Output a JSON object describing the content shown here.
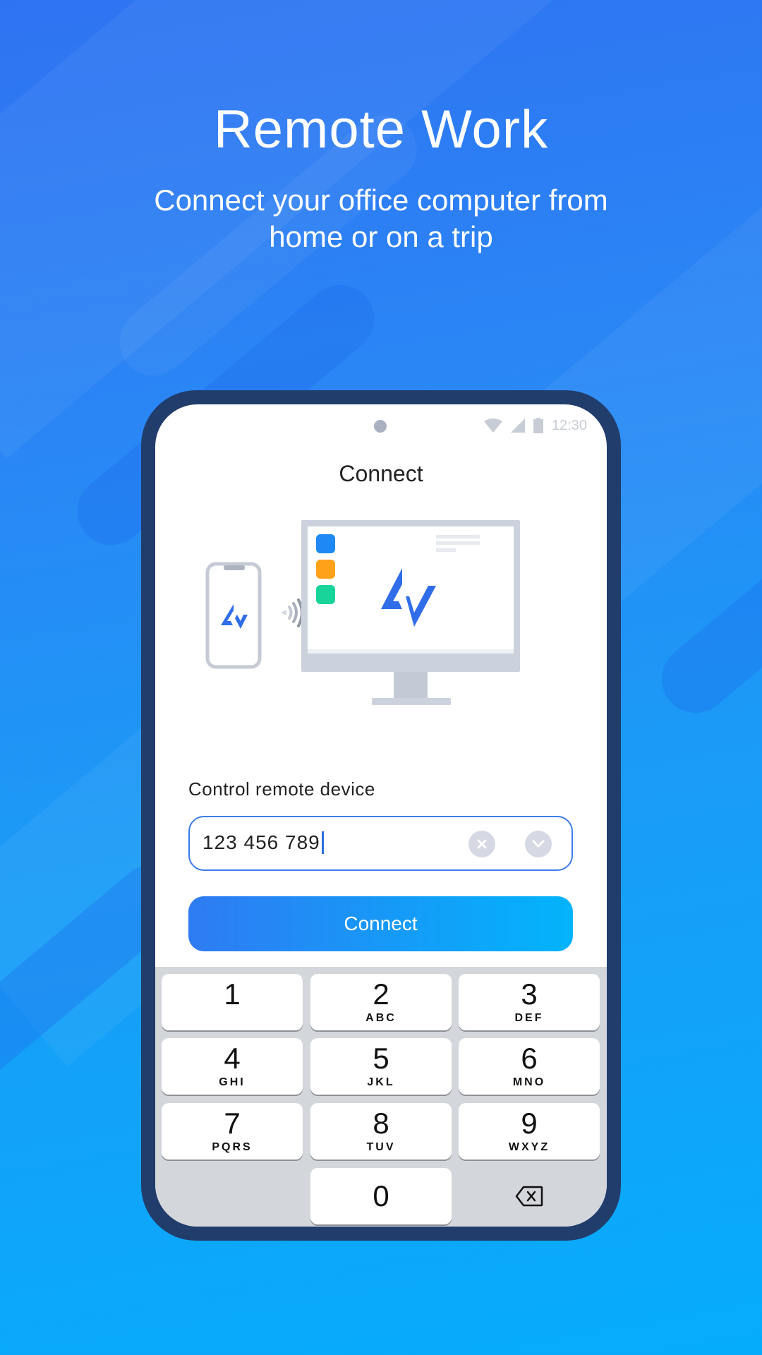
{
  "hero": {
    "title": "Remote Work",
    "subtitle_line1": "Connect your office computer from",
    "subtitle_line2": "home or on a trip"
  },
  "status_bar": {
    "time": "12:30",
    "icons": [
      "wifi-icon",
      "signal-icon",
      "battery-icon"
    ]
  },
  "screen": {
    "title": "Connect",
    "illustration": {
      "app_tile_colors": [
        "#1e88f5",
        "#ffa21a",
        "#18d49a"
      ],
      "logo_color": "#2f6de9"
    },
    "field_label": "Control remote device",
    "device_id_value": "123 456 789",
    "connect_button": "Connect"
  },
  "keypad": {
    "keys": [
      {
        "digit": "1",
        "letters": ""
      },
      {
        "digit": "2",
        "letters": "ABC"
      },
      {
        "digit": "3",
        "letters": "DEF"
      },
      {
        "digit": "4",
        "letters": "GHI"
      },
      {
        "digit": "5",
        "letters": "JKL"
      },
      {
        "digit": "6",
        "letters": "MNO"
      },
      {
        "digit": "7",
        "letters": "PQRS"
      },
      {
        "digit": "8",
        "letters": "TUV"
      },
      {
        "digit": "9",
        "letters": "WXYZ"
      }
    ],
    "zero": "0",
    "backspace_icon": "backspace-icon"
  },
  "colors": {
    "accent": "#2f7bf2",
    "accent_end": "#03b4fb",
    "phone_frame": "#213d6b",
    "keypad_bg": "#d3d6db"
  }
}
